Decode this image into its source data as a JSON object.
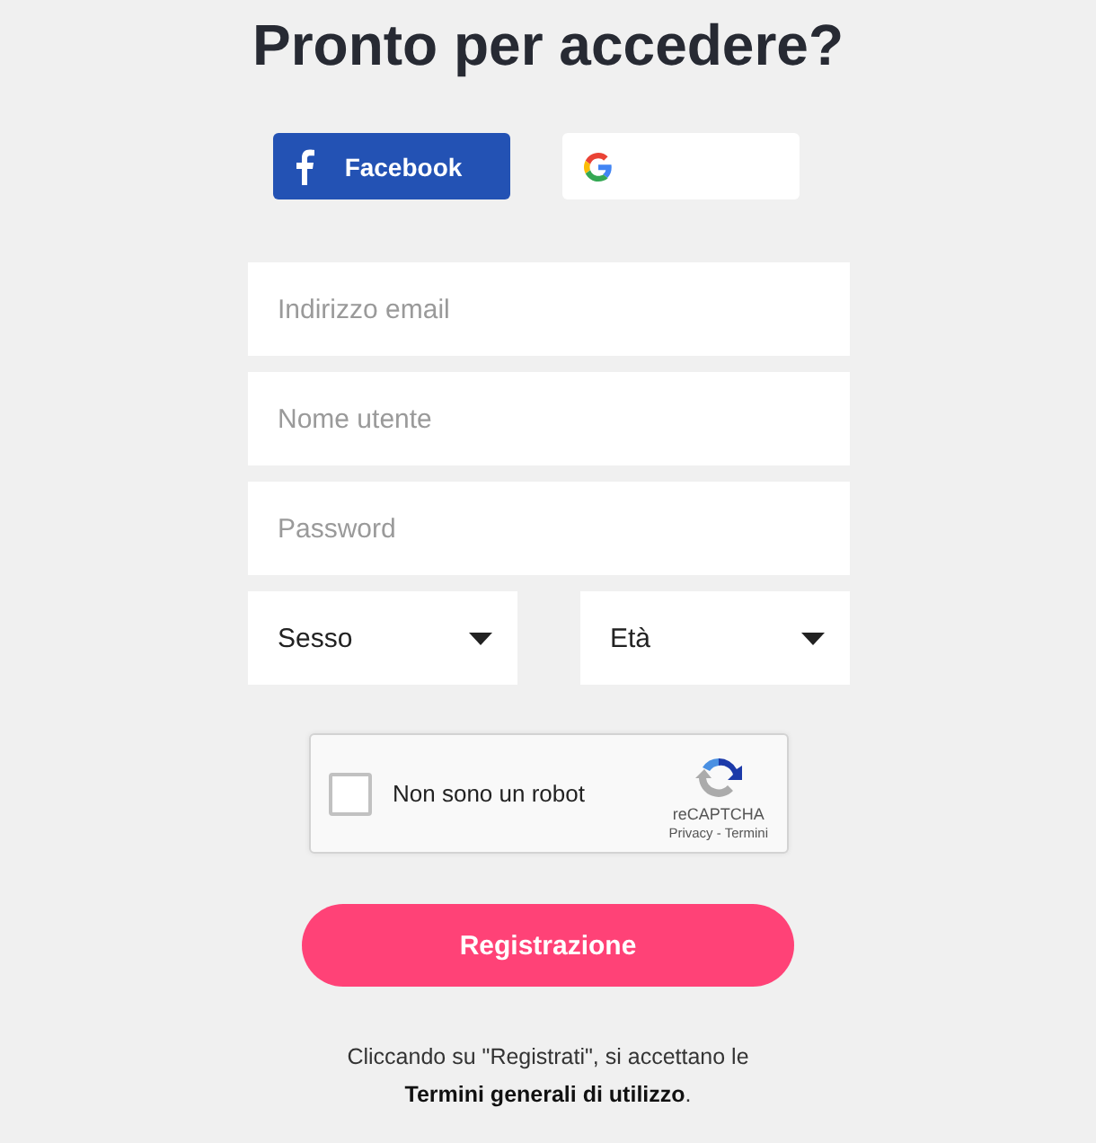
{
  "title": "Pronto per accedere?",
  "social_buttons": [
    {
      "kind": "facebook",
      "label": "Facebook"
    },
    {
      "kind": "google"
    }
  ],
  "fields": [
    {
      "placeholder": "Indirizzo email"
    },
    {
      "placeholder": "Nome utente"
    },
    {
      "placeholder": "Password"
    }
  ],
  "dropdowns": [
    {
      "label": "Sesso"
    },
    {
      "label": "Età"
    }
  ],
  "captcha": {
    "checked": false,
    "label": "Non sono un robot",
    "brand": "reCAPTCHA",
    "links": "Privacy - Termini"
  },
  "submit_button": "Registrazione",
  "footer": {
    "text": "Cliccando su \"Registrati\", si accettano le",
    "link": "Termini generali di utilizzo",
    "after": "."
  }
}
